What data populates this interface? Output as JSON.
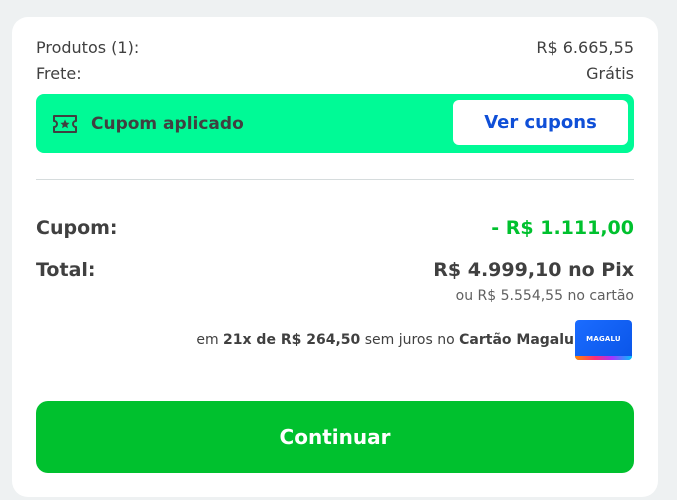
{
  "summary": {
    "produtos_label": "Produtos (1):",
    "produtos_value": "R$ 6.665,55",
    "frete_label": "Frete:",
    "frete_value": "Grátis"
  },
  "coupon": {
    "icon": "ticket-star-icon",
    "label": "Cupom aplicado",
    "button_label": "Ver cupons",
    "bar_color": "#00fa96",
    "button_text_color": "#0f4fd7"
  },
  "totals": {
    "cupom_label": "Cupom:",
    "cupom_value": "- R$ 1.111,00",
    "cupom_color": "#00c12e",
    "total_label": "Total:",
    "total_value": "R$ 4.999,10 no Pix",
    "cartao_value": "ou R$ 5.554,55 no cartão"
  },
  "installments": {
    "prefix": "em",
    "amount": "21x de R$ 264,50",
    "middle": "sem juros no",
    "card_name": "Cartão Magalu",
    "card_logo_text": "MAGALU"
  },
  "actions": {
    "continue_label": "Continuar",
    "continue_color": "#00c12e"
  }
}
